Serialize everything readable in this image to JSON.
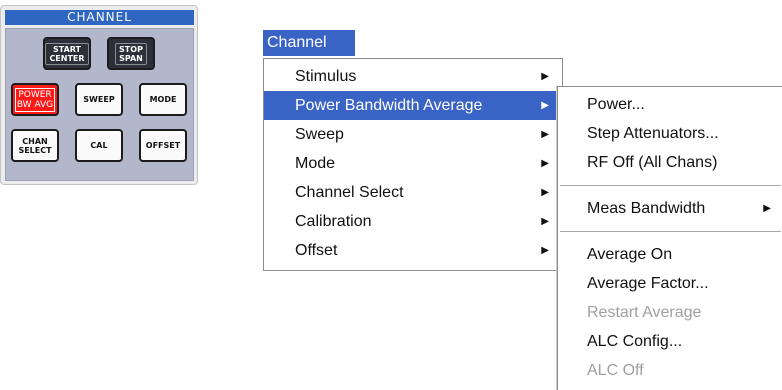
{
  "hardkey_panel": {
    "title": "CHANNEL",
    "keys": {
      "start_center": "START\nCENTER",
      "stop_span": "STOP\nSPAN",
      "power_bw_avg": "POWER\nBW AVG",
      "sweep": "SWEEP",
      "mode": "MODE",
      "chan_select": "CHAN\nSELECT",
      "cal": "CAL",
      "offset": "OFFSET"
    },
    "active_key_color": "#ff1a1a"
  },
  "menubar": {
    "title": "Channel"
  },
  "channel_menu": {
    "items": [
      {
        "label": "Stimulus",
        "submenu": true
      },
      {
        "label": "Power Bandwidth Average",
        "submenu": true,
        "highlighted": true
      },
      {
        "label": "Sweep",
        "submenu": true
      },
      {
        "label": "Mode",
        "submenu": true
      },
      {
        "label": "Channel Select",
        "submenu": true
      },
      {
        "label": "Calibration",
        "submenu": true
      },
      {
        "label": "Offset",
        "submenu": true
      }
    ]
  },
  "power_submenu": {
    "items": [
      {
        "label": "Power...",
        "enabled": true
      },
      {
        "label": "Step Attenuators...",
        "enabled": true
      },
      {
        "label": "RF Off (All Chans)",
        "enabled": true
      },
      {
        "label": "Meas Bandwidth",
        "enabled": true,
        "submenu": true
      },
      {
        "label": "Average On",
        "enabled": true
      },
      {
        "label": "Average Factor...",
        "enabled": true
      },
      {
        "label": "Restart Average",
        "enabled": false
      },
      {
        "label": "ALC Config...",
        "enabled": true
      },
      {
        "label": "ALC Off",
        "enabled": false
      }
    ]
  },
  "arrow_glyph": "▶",
  "highlight_color": "#3a63c6"
}
